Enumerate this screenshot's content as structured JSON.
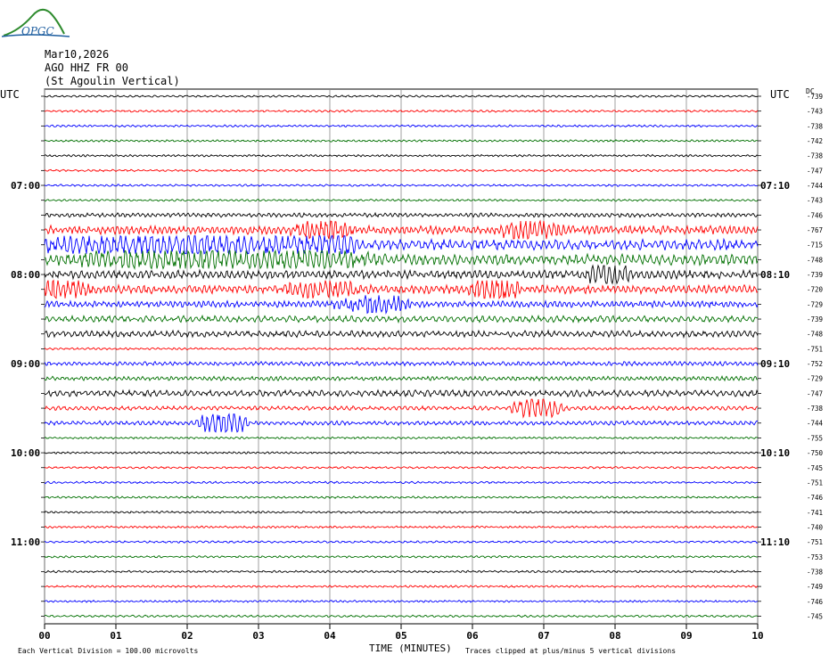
{
  "logo": {
    "text": "OPGC"
  },
  "header": {
    "date": "Mar10,2026",
    "station": "AGO HHZ FR 00",
    "station_name": "(St Agoulin Vertical)"
  },
  "axes": {
    "left_tz": "UTC",
    "right_tz": "UTC",
    "right_unit": "DC",
    "xlabel": "TIME (MINUTES)"
  },
  "footer": {
    "scale_note": "Each Vertical Division =  100.00 microvolts",
    "clip_note": "Traces clipped at plus/minus 5 vertical divisions"
  },
  "colors": {
    "trace_cycle": [
      "#000000",
      "#ff0000",
      "#0000ff",
      "#007000"
    ],
    "grid": "#888888"
  },
  "chart_data": {
    "type": "line",
    "title": "AGO HHZ FR 00 (St Agoulin Vertical)",
    "date": "Mar10,2026",
    "x": {
      "label": "TIME (MINUTES)",
      "ticks": [
        "00",
        "01",
        "02",
        "03",
        "04",
        "05",
        "06",
        "07",
        "08",
        "09",
        "10"
      ],
      "range": [
        0,
        10
      ]
    },
    "left_time_labels": [
      "07:00",
      "08:00",
      "09:00",
      "10:00",
      "11:00"
    ],
    "right_time_labels": [
      "07:10",
      "08:10",
      "09:10",
      "10:10",
      "11:10"
    ],
    "traces_per_hour": 6,
    "trace_count": 36,
    "dc_offsets": [
      -739,
      -743,
      -738,
      -742,
      -738,
      -747,
      -744,
      -743,
      -746,
      -767,
      -715,
      -748,
      -739,
      -720,
      -729,
      -739,
      -748,
      -751,
      -752,
      -729,
      -747,
      -738,
      -744,
      -755,
      -750,
      -745,
      -751,
      -746,
      -741,
      -740,
      -751,
      -753,
      -738,
      -749,
      -746,
      -745
    ],
    "trace_amplitude": [
      1,
      1,
      1,
      1,
      1,
      1,
      1,
      1,
      2,
      4,
      5,
      5,
      4,
      4,
      3,
      3,
      3,
      1,
      2,
      2,
      3,
      2,
      2,
      1,
      1,
      1,
      1,
      1,
      1,
      1,
      1,
      1,
      1,
      1,
      1,
      1
    ],
    "events": [
      {
        "trace": 9,
        "minute": 3.9,
        "width": 0.5,
        "amp": 7
      },
      {
        "trace": 9,
        "minute": 6.8,
        "width": 0.5,
        "amp": 8
      },
      {
        "trace": 10,
        "minute": 1.6,
        "width": 2.6,
        "amp": 6
      },
      {
        "trace": 10,
        "minute": 4.0,
        "width": 0.5,
        "amp": 8
      },
      {
        "trace": 11,
        "minute": 2.5,
        "width": 2.4,
        "amp": 7
      },
      {
        "trace": 12,
        "minute": 7.9,
        "width": 0.35,
        "amp": 10
      },
      {
        "trace": 13,
        "minute": 0.2,
        "width": 0.5,
        "amp": 8
      },
      {
        "trace": 13,
        "minute": 3.9,
        "width": 0.6,
        "amp": 6
      },
      {
        "trace": 13,
        "minute": 6.3,
        "width": 0.4,
        "amp": 12
      },
      {
        "trace": 14,
        "minute": 4.6,
        "width": 0.6,
        "amp": 7
      },
      {
        "trace": 21,
        "minute": 6.9,
        "width": 0.4,
        "amp": 12
      },
      {
        "trace": 22,
        "minute": 2.5,
        "width": 0.4,
        "amp": 12
      }
    ],
    "clip_divisions": 5,
    "vertical_division_uV": 100.0
  }
}
